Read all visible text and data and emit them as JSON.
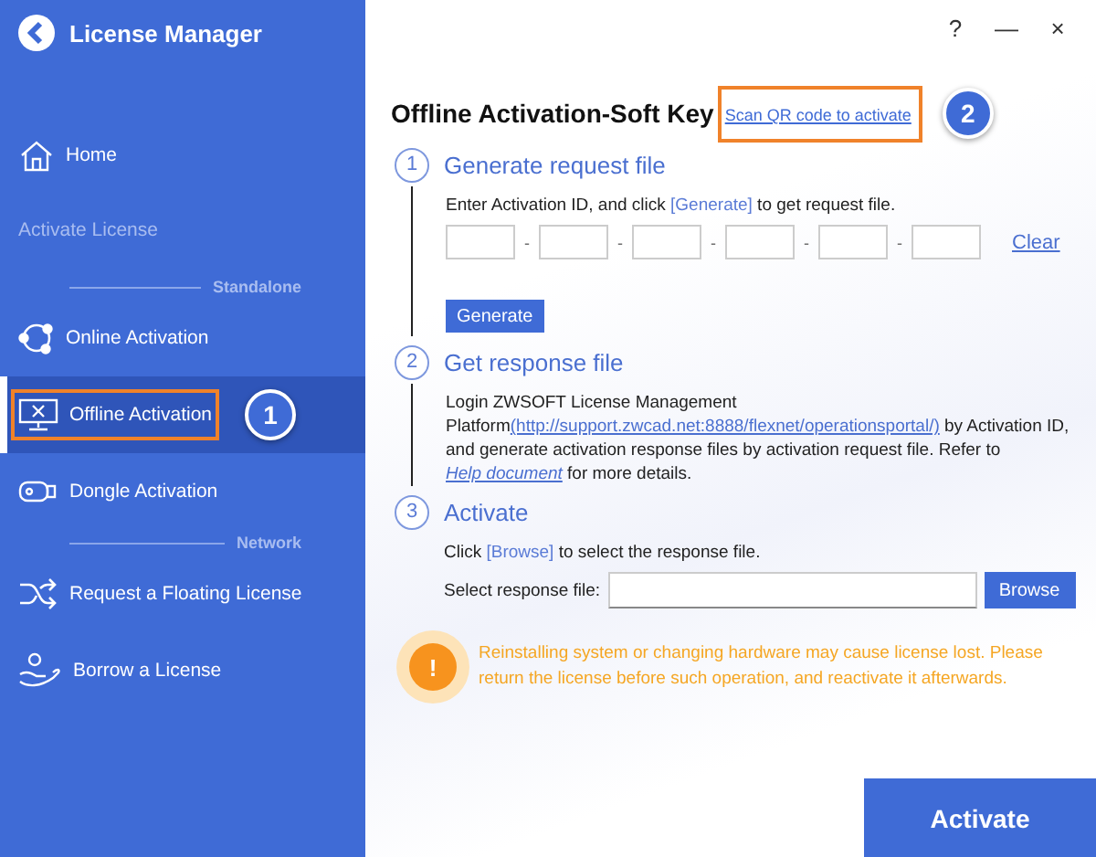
{
  "sidebar": {
    "title": "License Manager",
    "items": [
      {
        "kind": "nav",
        "label": "Home",
        "selected": false
      },
      {
        "kind": "heading",
        "label": "Activate License"
      },
      {
        "kind": "section",
        "label": "Standalone"
      },
      {
        "kind": "nav",
        "label": "Online Activation",
        "selected": false
      },
      {
        "kind": "nav",
        "label": "Offline Activation",
        "selected": true,
        "callout": "1"
      },
      {
        "kind": "nav",
        "label": "Dongle Activation",
        "selected": false
      },
      {
        "kind": "section",
        "label": "Network"
      },
      {
        "kind": "nav",
        "label": "Request a Floating License",
        "selected": false
      },
      {
        "kind": "nav",
        "label": "Borrow a License",
        "selected": false
      }
    ]
  },
  "window_controls": [
    "?",
    "—",
    "×"
  ],
  "main": {
    "title": "Offline Activation-Soft Key",
    "qr_link": "Scan QR code to activate",
    "qr_callout": "2",
    "step1": {
      "number": "1",
      "title": "Generate request file",
      "text": [
        "Enter Activation ID, and click ",
        "[Generate]",
        " to get request file."
      ],
      "separators": [
        "-",
        "-",
        "-",
        "-",
        "-"
      ],
      "clear": "Clear",
      "button": "Generate"
    },
    "step2": {
      "number": "2",
      "title": "Get response file",
      "text": [
        "Login ZWSOFT License Management Platform",
        "(http://support.zwcad.net:8888/flexnet/operationsportal/)",
        " by Activation ID, and generate activation response files by activation request file. Refer to ",
        "Help document",
        " for more details."
      ]
    },
    "step3": {
      "number": "3",
      "title": "Activate",
      "text": [
        "Click ",
        "[Browse]",
        " to select the response file."
      ],
      "file_label": "Select response file:",
      "button": "Browse"
    },
    "warning": {
      "icon": "!",
      "text": "Reinstalling system or changing hardware may cause license lost. Please return the license before such operation, and reactivate it afterwards."
    },
    "activate_button": "Activate"
  }
}
